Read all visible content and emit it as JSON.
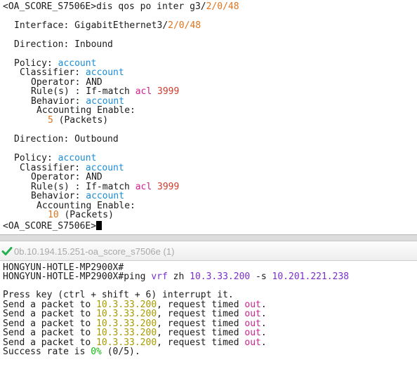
{
  "top": {
    "prompt1": "<OA_SCORE_S7506E>",
    "cmd": "dis qos po inter g3/",
    "cmd_num": "2/0/48",
    "interface_label": "Interface: GigabitEthernet3/",
    "interface_num": "2/0/48",
    "direction_in": "Direction: Inbound",
    "dir_out": "Direction: Outbound",
    "policy_label": "Policy: ",
    "policy_name": "account",
    "classifier_label": "Classifier: ",
    "classifier_name": "account",
    "operator": "Operator: AND",
    "rule_label": "Rule(s) : If-match ",
    "rule_acl": "acl",
    "rule_num": "3999",
    "behavior_label": "Behavior: ",
    "behavior_name": "account",
    "accounting": "Accounting Enable:",
    "in_count": "5",
    "out_count": "10",
    "packets": " (Packets)",
    "prompt2": "<OA_SCORE_S7506E>"
  },
  "tab": {
    "title": "0b.10.194.15.251-oa_score_s7506e (1)"
  },
  "bottom": {
    "host1": "HONGYUN-HOTLE-MP2900X#",
    "host2": "HONGYUN-HOTLE-MP2900X#",
    "ping": "ping ",
    "vrf": "vrf",
    "zh": " zh ",
    "ip1": "10.3.33.200",
    "s_opt": " -s ",
    "ip2": "10.201.221.238",
    "press": "Press key (ctrl + shift + 6) interrupt it.",
    "send_prefix": "Send a packet to ",
    "send_dest": "10.3.33.200",
    "send_mid": ", request timed ",
    "send_out": "out",
    "send_end": ".",
    "success_label": "Success rate is ",
    "success_pct": "0%",
    "success_frac": "(0/5)",
    "success_end": "."
  },
  "colors": {
    "number": "#e0741e",
    "keyword": "#1a8cd8",
    "acl": "#cc1f8c",
    "timeout": "#cc1f8c",
    "success": "#12b712",
    "check": "#22b14c"
  }
}
